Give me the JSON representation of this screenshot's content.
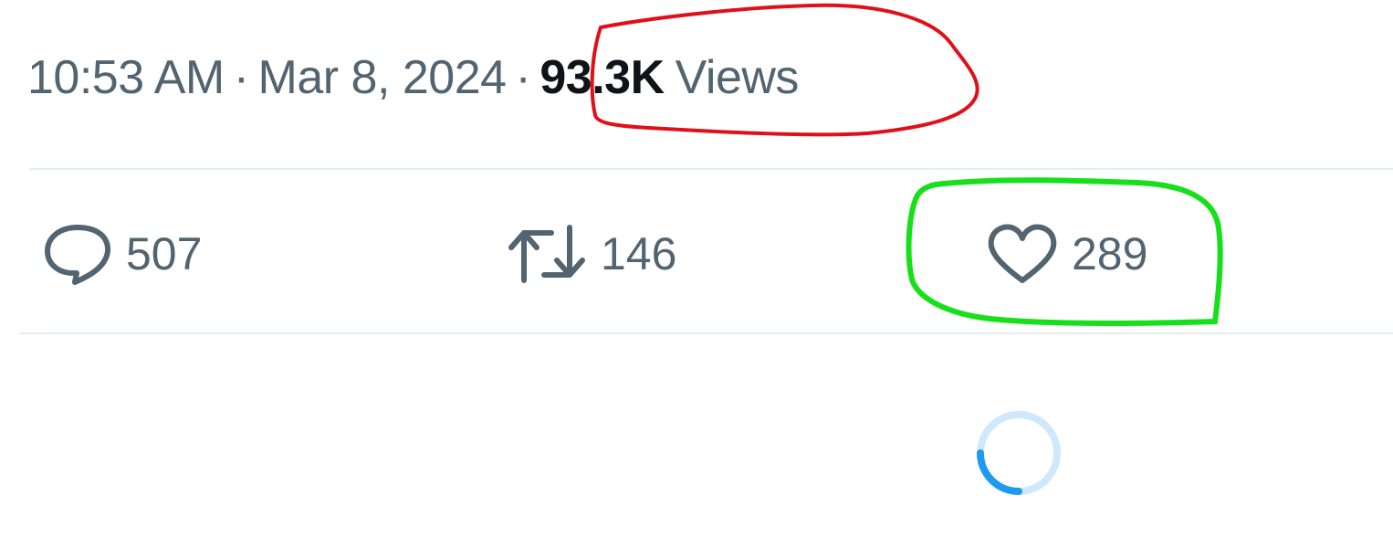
{
  "tweet_meta": {
    "time": "10:53 AM",
    "separator": "·",
    "date": "Mar 8, 2024",
    "views_count": "93.3K",
    "views_label": "Views"
  },
  "actions": {
    "reply_count": "507",
    "retweet_count": "146",
    "like_count": "289"
  },
  "icons": {
    "reply": "speech-bubble-icon",
    "retweet": "retweet-arrows-icon",
    "like": "heart-icon",
    "loading": "loading-spinner-icon"
  },
  "colors": {
    "meta_text": "#536471",
    "views_count": "#0f1419",
    "divider": "#e6ecf0",
    "spinner_accent": "#1d9bf0",
    "annotation_red": "#e0101a",
    "annotation_green": "#16e01a"
  }
}
